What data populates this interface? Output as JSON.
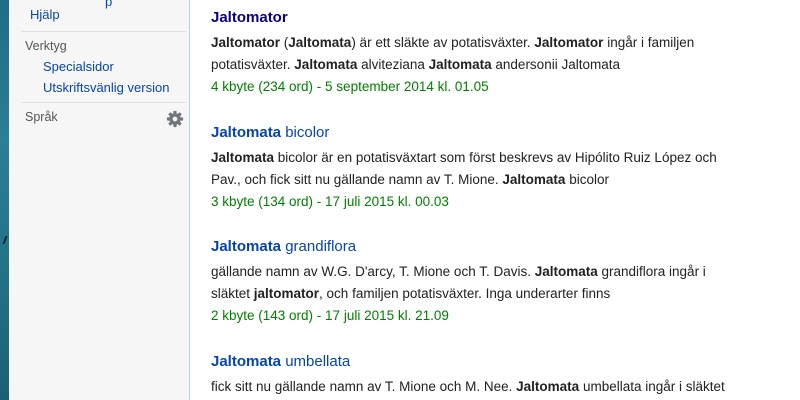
{
  "sidebar": {
    "cut_link": "p",
    "help_link": "Hjälp",
    "tools_heading": "Verktyg",
    "tools": [
      "Specialsidor",
      "Utskriftsvänlig version"
    ],
    "languages_heading": "Språk",
    "gear_icon": "gear-icon"
  },
  "results": [
    {
      "title_match": "Jaltomator",
      "title_rest": "",
      "snippet": [
        [
          "Jaltomator",
          " (",
          "Jaltomata",
          ") är ett släkte av potatisväxter. ",
          "Jaltomator",
          " ingår i familjen"
        ],
        [
          "potatisväxter. ",
          "Jaltomata",
          " alviteziana ",
          "Jaltomata",
          " andersonii Jaltomata"
        ]
      ],
      "meta": "4 kbyte (234 ord) - 5 september 2014 kl. 01.05"
    },
    {
      "title_match": "Jaltomata",
      "title_rest": " bicolor",
      "snippet": [
        [
          "Jaltomata",
          " bicolor är en potatisväxtart som först beskrevs av Hipólito Ruiz López och"
        ],
        [
          "Pav., och fick sitt nu gällande namn av T. Mione. ",
          "Jaltomata",
          " bicolor"
        ]
      ],
      "meta": "3 kbyte (134 ord) - 17 juli 2015 kl. 00.03"
    },
    {
      "title_match": "Jaltomata",
      "title_rest": " grandiflora",
      "snippet": [
        [
          "gällande namn av W.G. D'arcy, T. Mione och T. Davis. ",
          "Jaltomata",
          " grandiflora ingår i"
        ],
        [
          "släktet ",
          "jaltomator",
          ", och familjen potatisväxter. Inga underarter finns"
        ]
      ],
      "meta": "2 kbyte (143 ord) - 17 juli 2015 kl. 21.09"
    },
    {
      "title_match": "Jaltomata",
      "title_rest": " umbellata",
      "snippet": [
        [
          "fick sitt nu gällande namn av T. Mione och M. Nee. ",
          "Jaltomata",
          " umbellata ingår i släktet"
        ]
      ]
    }
  ]
}
